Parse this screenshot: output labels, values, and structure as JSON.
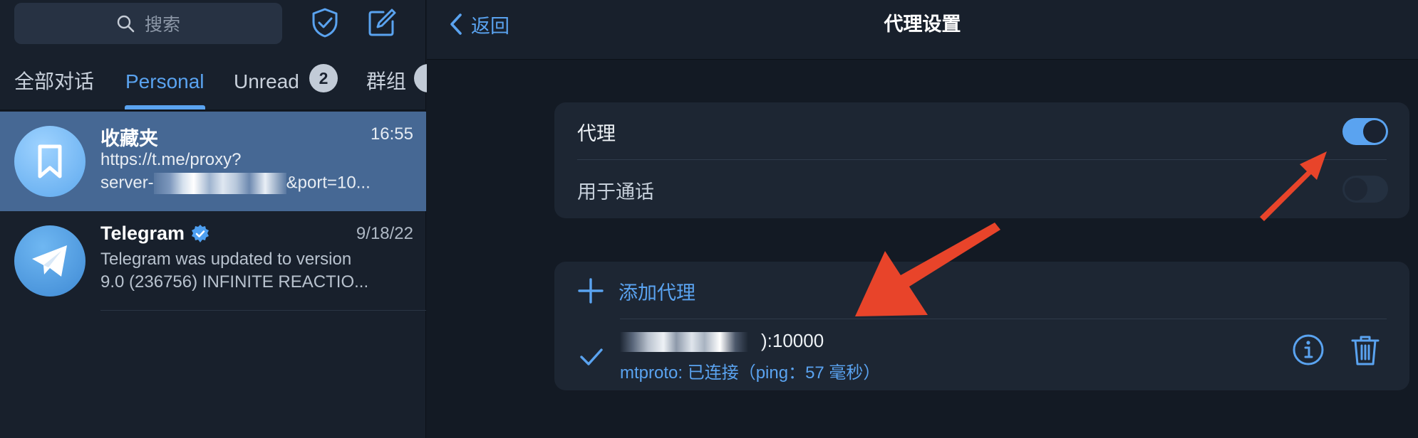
{
  "sidebar": {
    "search_placeholder": "搜索",
    "tabs": [
      {
        "label": "全部对话"
      },
      {
        "label": "Personal"
      },
      {
        "label": "Unread",
        "badge": "2"
      },
      {
        "label": "群组"
      }
    ],
    "chats": [
      {
        "title": "收藏夹",
        "time": "16:55",
        "line1": "https://t.me/proxy?",
        "line2_prefix": "server-",
        "line2_suffix": "&port=10..."
      },
      {
        "title": "Telegram",
        "time": "9/18/22",
        "line1": "Telegram was updated to version",
        "line2": "9.0 (236756)  INFINITE REACTIO..."
      }
    ]
  },
  "navbar": {
    "back_label": "返回",
    "title": "代理设置"
  },
  "settings": {
    "proxy_label": "代理",
    "proxy_enabled": true,
    "calls_label": "用于通话",
    "calls_enabled": false,
    "add_proxy_label": "添加代理",
    "proxy_address_suffix": "):10000",
    "proxy_status": "mtproto: 已连接（ping：57 毫秒）"
  },
  "colors": {
    "accent": "#5aa3f0",
    "annotation_arrow": "#e8442a",
    "selected_chat": "#466894"
  }
}
